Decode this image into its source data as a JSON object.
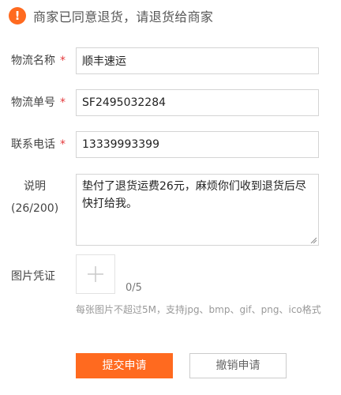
{
  "notice": {
    "icon": "exclamation-icon",
    "text": "商家已同意退货，请退货给商家",
    "icon_color": "#ff6a1f"
  },
  "form": {
    "required_mark": "*",
    "logistics_name": {
      "label": "物流名称",
      "value": "顺丰速运"
    },
    "tracking_number": {
      "label": "物流单号",
      "value": "SF2495032284"
    },
    "phone": {
      "label": "联系电话",
      "value": "13339993399"
    },
    "description": {
      "label": "说明",
      "counter": "(26/200)",
      "value": "垫付了退货运费26元，麻烦你们收到退货后尽快打给我。"
    },
    "images": {
      "label": "图片凭证",
      "count": "0/5",
      "hint": "每张图片不超过5M，支持jpg、bmp、gif、png、ico格式"
    }
  },
  "actions": {
    "submit_label": "提交申请",
    "cancel_label": "撤销申请"
  },
  "colors": {
    "accent": "#ff6a1f",
    "required": "#e4393c"
  }
}
